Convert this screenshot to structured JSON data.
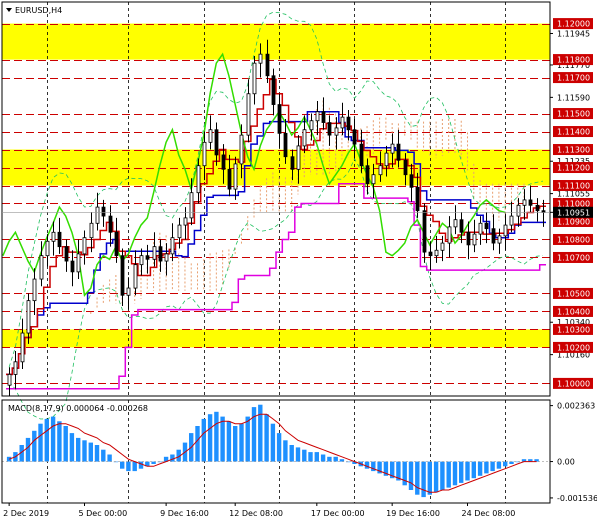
{
  "symbol_label": "EURUSD,H4",
  "macd_label": "MACD(8,17,9) 0.000064 -0.000268",
  "colors": {
    "background": "#ffffff",
    "band": "#ffff00",
    "level_line": "#cc0000",
    "price_bar": "#000000",
    "cloud": "#e8a070",
    "tenkan": "#cc0000",
    "kijun": "#0000cc",
    "chikou": "#33dd00",
    "bb": "#20c060",
    "lower_bound": "#e000e0",
    "macd_hist": "#1e90ff",
    "macd_signal": "#cc0000",
    "grid": "#000000",
    "axis_text": "#000000",
    "highlight_label_bg": "#cc0000",
    "highlight_label_text": "#ffffff"
  },
  "chart_data": [
    {
      "type": "candlestick",
      "title": "EURUSD,H4",
      "ylim": [
        1.0993,
        1.1212
      ],
      "highlighted_levels": [
        1.12,
        1.118,
        1.117,
        1.115,
        1.114,
        1.113,
        1.112,
        1.111,
        1.11,
        1.109,
        1.108,
        1.107,
        1.105,
        1.104,
        1.103,
        1.102,
        1.1
      ],
      "plain_ticks": [
        1.11945,
        1.1177,
        1.1159,
        1.11235,
        1.11055,
        1.10951,
        1.1034,
        1.1016
      ],
      "current_price": 1.10951,
      "bands": [
        [
          1.118,
          1.12
        ],
        [
          1.111,
          1.113
        ],
        [
          1.102,
          1.103
        ]
      ],
      "level_lines": [
        1.12,
        1.118,
        1.117,
        1.115,
        1.114,
        1.113,
        1.112,
        1.111,
        1.11,
        1.108,
        1.107,
        1.105,
        1.104,
        1.103,
        1.102,
        1.1
      ],
      "x_labels": [
        "2 Dec 2019",
        "5 Dec 00:00",
        "9 Dec 16:00",
        "12 Dec 08:00",
        "17 Dec 00:00",
        "19 Dec 16:00",
        "24 Dec 08:00"
      ],
      "series_close": [
        1.1005,
        1.1012,
        1.1028,
        1.1046,
        1.1058,
        1.1071,
        1.1079,
        1.1084,
        1.1076,
        1.1068,
        1.1062,
        1.1072,
        1.1081,
        1.1089,
        1.1098,
        1.1093,
        1.1084,
        1.1071,
        1.1049,
        1.1053,
        1.1066,
        1.1071,
        1.1069,
        1.1076,
        1.1068,
        1.1072,
        1.1081,
        1.1088,
        1.1092,
        1.1106,
        1.1121,
        1.1134,
        1.1141,
        1.1127,
        1.1119,
        1.1108,
        1.1122,
        1.1138,
        1.1161,
        1.1178,
        1.1183,
        1.1171,
        1.1155,
        1.1139,
        1.1126,
        1.1119,
        1.1132,
        1.1141,
        1.1146,
        1.1151,
        1.1145,
        1.1138,
        1.1142,
        1.1148,
        1.1141,
        1.1133,
        1.1121,
        1.1111,
        1.1116,
        1.1121,
        1.1128,
        1.1133,
        1.1124,
        1.1116,
        1.1109,
        1.1096,
        1.1073,
        1.1071,
        1.1074,
        1.1078,
        1.1087,
        1.1091,
        1.1084,
        1.1077,
        1.1083,
        1.1089,
        1.1086,
        1.1078,
        1.1082,
        1.1088,
        1.1093,
        1.1099,
        1.1102,
        1.1099,
        1.1096,
        1.1095
      ]
    },
    {
      "type": "bar",
      "title": "MACD(8,17,9) 0.000064 -0.000268",
      "ylim": [
        -0.00175,
        0.0026
      ],
      "y_ticks": [
        0.002363,
        0.0,
        -0.001536
      ],
      "y_tick_labels": [
        "0.002363",
        "0.00",
        "-0.001536"
      ],
      "macd_histogram": [
        0.0002,
        0.0004,
        0.0007,
        0.001,
        0.0013,
        0.0016,
        0.0018,
        0.0019,
        0.0017,
        0.0015,
        0.0012,
        0.001,
        0.0009,
        0.0008,
        0.0007,
        0.0005,
        0.0003,
        0.0,
        -0.0003,
        -0.0004,
        -0.0004,
        -0.0003,
        -0.0002,
        -0.0001,
        0.0,
        0.0002,
        0.0003,
        0.0005,
        0.0008,
        0.0012,
        0.0015,
        0.0018,
        0.002,
        0.0021,
        0.0019,
        0.0017,
        0.0015,
        0.0016,
        0.0019,
        0.0023,
        0.0024,
        0.002,
        0.0016,
        0.0012,
        0.0009,
        0.0007,
        0.0006,
        0.0005,
        0.0004,
        0.0004,
        0.0003,
        0.0002,
        0.0002,
        0.0001,
        0.0,
        -0.0001,
        -0.0002,
        -0.0003,
        -0.0004,
        -0.0005,
        -0.0006,
        -0.0007,
        -0.0008,
        -0.001,
        -0.0012,
        -0.0014,
        -0.0015,
        -0.0014,
        -0.0013,
        -0.0012,
        -0.0011,
        -0.001,
        -0.0009,
        -0.0008,
        -0.0007,
        -0.0006,
        -0.0005,
        -0.0004,
        -0.0003,
        -0.0002,
        -0.0001,
        0.0,
        0.0001,
        0.0001,
        0.0001
      ],
      "signal_line": [
        0.0001,
        0.0002,
        0.0004,
        0.0006,
        0.0009,
        0.0011,
        0.0013,
        0.0015,
        0.0016,
        0.0016,
        0.0015,
        0.0014,
        0.0012,
        0.0011,
        0.001,
        0.0008,
        0.0007,
        0.0005,
        0.0003,
        0.0001,
        0.0,
        -0.0001,
        -0.0002,
        -0.0002,
        -0.0001,
        0.0,
        0.0001,
        0.0002,
        0.0004,
        0.0006,
        0.0009,
        0.0012,
        0.0014,
        0.0016,
        0.0017,
        0.0017,
        0.0016,
        0.0016,
        0.0017,
        0.0019,
        0.002,
        0.002,
        0.0018,
        0.0016,
        0.0013,
        0.0011,
        0.0009,
        0.0008,
        0.0007,
        0.0006,
        0.0005,
        0.0004,
        0.0003,
        0.0002,
        0.0001,
        0.0,
        -0.0001,
        -0.0002,
        -0.0003,
        -0.0004,
        -0.0005,
        -0.0006,
        -0.0007,
        -0.0008,
        -0.0009,
        -0.0011,
        -0.0012,
        -0.0013,
        -0.0013,
        -0.0012,
        -0.0012,
        -0.0011,
        -0.001,
        -0.0009,
        -0.0008,
        -0.0007,
        -0.0006,
        -0.0005,
        -0.0004,
        -0.0003,
        -0.0002,
        -0.0001,
        0.0,
        0.0,
        0.0
      ]
    }
  ]
}
